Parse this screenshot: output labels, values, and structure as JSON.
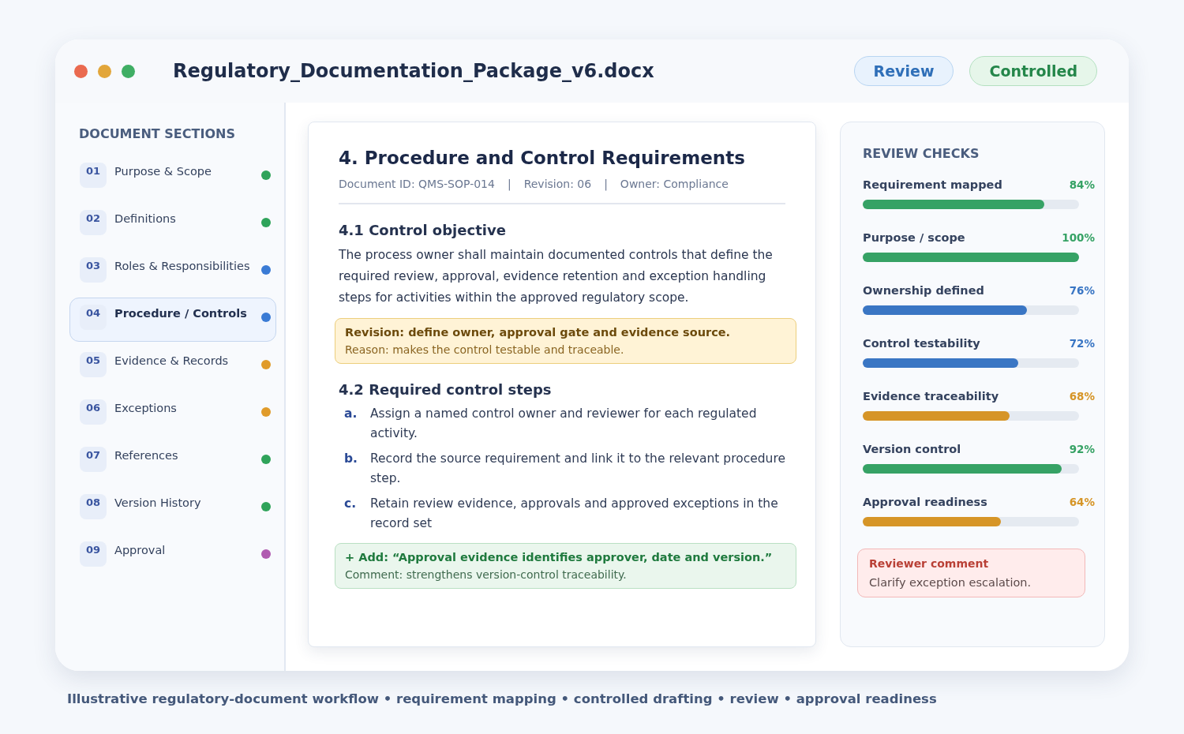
{
  "window": {
    "title": "Regulatory_Documentation_Package_v6.docx",
    "badges": [
      {
        "label": "Review",
        "kind": "review"
      },
      {
        "label": "Controlled",
        "kind": "controlled"
      }
    ]
  },
  "sidebar": {
    "title": "DOCUMENT SECTIONS",
    "items": [
      {
        "number": "01",
        "label": "Purpose & Scope",
        "color": "#2fa35a",
        "selected": false
      },
      {
        "number": "02",
        "label": "Definitions",
        "color": "#2fa35a",
        "selected": false
      },
      {
        "number": "03",
        "label": "Roles & Responsibilities",
        "color": "#3a7bd5",
        "selected": false
      },
      {
        "number": "04",
        "label": "Procedure / Controls",
        "color": "#3a7bd5",
        "selected": true
      },
      {
        "number": "05",
        "label": "Evidence & Records",
        "color": "#e09b2a",
        "selected": false
      },
      {
        "number": "06",
        "label": "Exceptions",
        "color": "#e09b2a",
        "selected": false
      },
      {
        "number": "07",
        "label": "References",
        "color": "#2fa35a",
        "selected": false
      },
      {
        "number": "08",
        "label": "Version History",
        "color": "#2fa35a",
        "selected": false
      },
      {
        "number": "09",
        "label": "Approval",
        "color": "#b05bb0",
        "selected": false
      }
    ]
  },
  "document": {
    "title": "4. Procedure and Control Requirements",
    "meta": [
      "Document ID: QMS-SOP-014",
      "Revision: 06",
      "Owner: Compliance"
    ],
    "meta_separator": "|",
    "sections": [
      {
        "heading": "4.1 Control objective",
        "paragraph": "The process owner shall maintain documented controls that define the required review, approval, evidence retention and exception handling steps for activities within the approved regulatory scope.",
        "note": {
          "kind": "revision",
          "title": "Revision: define owner, approval gate and evidence source.",
          "text": "Reason: makes the control testable and traceable."
        }
      },
      {
        "heading": "4.2 Required control steps",
        "steps": [
          {
            "marker": "a.",
            "text": "Assign a named control owner and reviewer for each regulated activity."
          },
          {
            "marker": "b.",
            "text": "Record the source requirement and link it to the relevant procedure step."
          },
          {
            "marker": "c.",
            "text": "Retain review evidence, approvals and approved exceptions in the record set"
          }
        ],
        "note": {
          "kind": "addition",
          "title": "+ Add: “Approval evidence identifies approver, date and version.”",
          "text": "Comment: strengthens version-control traceability."
        }
      }
    ]
  },
  "review_checks": {
    "title": "REVIEW CHECKS",
    "items": [
      {
        "label": "Requirement mapped",
        "reading": "84%",
        "level": 0.84,
        "color": "#36a265"
      },
      {
        "label": "Purpose / scope",
        "reading": "100%",
        "level": 1.0,
        "color": "#36a265"
      },
      {
        "label": "Ownership defined",
        "reading": "76%",
        "level": 0.76,
        "color": "#3a76c4"
      },
      {
        "label": "Control testability",
        "reading": "72%",
        "level": 0.72,
        "color": "#3a76c4"
      },
      {
        "label": "Evidence traceability",
        "reading": "68%",
        "level": 0.68,
        "color": "#d69527"
      },
      {
        "label": "Version control",
        "reading": "92%",
        "level": 0.92,
        "color": "#36a265"
      },
      {
        "label": "Approval readiness",
        "reading": "64%",
        "level": 0.64,
        "color": "#d69527"
      }
    ],
    "comment": {
      "title": "Reviewer comment",
      "text": "Clarify exception escalation."
    }
  },
  "caption": "Illustrative regulatory-document workflow • requirement mapping • controlled drafting • review • approval readiness"
}
